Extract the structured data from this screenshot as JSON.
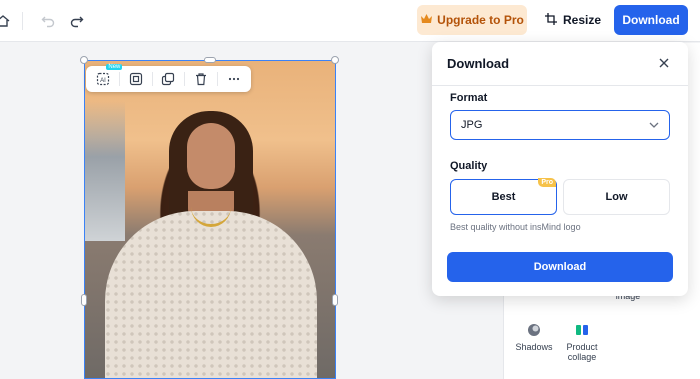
{
  "toolbar": {
    "upgrade_label": "Upgrade to Pro",
    "resize_label": "Resize",
    "download_label": "Download"
  },
  "image_toolbar": {
    "new_badge": "New"
  },
  "dialog": {
    "title": "Download",
    "format_label": "Format",
    "format_value": "JPG",
    "quality_label": "Quality",
    "quality_options": [
      "Best",
      "Low"
    ],
    "pro_badge": "Pro",
    "hint": "Best quality without insMind logo",
    "download_button": "Download"
  },
  "right_panel": {
    "items": [
      {
        "label": "image",
        "icon": "image-icon"
      },
      {
        "label": "Shadows",
        "icon": "shadows-icon"
      },
      {
        "label": "Product collage",
        "icon": "collage-icon"
      }
    ]
  },
  "colors": {
    "accent": "#2563eb",
    "upgrade_bg": "#fde9d2",
    "upgrade_text": "#b45309",
    "pro_badge": "#f6c24a",
    "new_badge": "#22d3ee"
  }
}
